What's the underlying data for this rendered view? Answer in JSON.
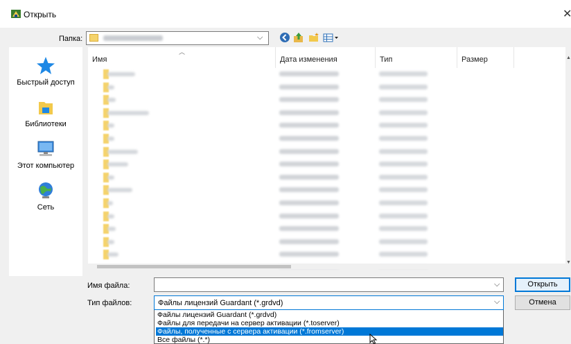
{
  "window": {
    "title": "Открыть",
    "close_glyph": "✕"
  },
  "toolbar": {
    "folder_label": "Папка:",
    "buttons": [
      {
        "name": "back-icon",
        "glyph": "◀",
        "color": "#4a7ebb"
      },
      {
        "name": "up-folder-icon",
        "glyph": "⬆",
        "color": "#3c9c3c"
      },
      {
        "name": "new-folder-icon",
        "glyph": "✱",
        "color": "#e8a515"
      },
      {
        "name": "view-menu-icon",
        "glyph": "▦▾",
        "color": "#2c6fb7"
      }
    ]
  },
  "places": [
    {
      "name": "quick-access",
      "label": "Быстрый доступ",
      "icon": "star-icon"
    },
    {
      "name": "libraries",
      "label": "Библиотеки",
      "icon": "library-icon"
    },
    {
      "name": "this-pc",
      "label": "Этот компьютер",
      "icon": "computer-icon"
    },
    {
      "name": "network",
      "label": "Сеть",
      "icon": "network-icon"
    }
  ],
  "list": {
    "columns": [
      "Имя",
      "Дата изменения",
      "Тип",
      "Размер"
    ],
    "row_count": 15,
    "rows_name_widths": [
      40,
      10,
      12,
      60,
      10,
      10,
      44,
      30,
      10,
      36,
      8,
      10,
      12,
      10,
      16
    ]
  },
  "bottom": {
    "filename_label": "Имя файла:",
    "filename_value": "",
    "filetype_label": "Тип файлов:",
    "filetype_value": "Файлы лицензий Guardant (*.grdvd)",
    "open_label": "Открыть",
    "cancel_label": "Отмена"
  },
  "dropdown": {
    "options": [
      "Файлы лицензий Guardant (*.grdvd)",
      "Файлы для передачи на сервер активации (*.toserver)",
      "Файлы, полученные с сервера активации (*.fromserver)",
      "Все файлы (*.*)"
    ],
    "selected_index": 2
  },
  "colors": {
    "accent": "#0078d7",
    "folder": "#f5d36b",
    "dialog_bg": "#f0f0f0"
  }
}
